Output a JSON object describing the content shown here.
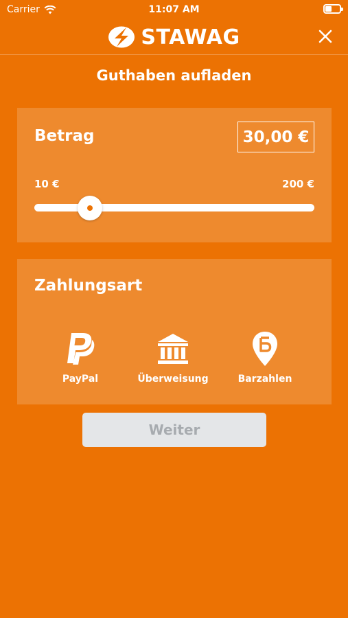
{
  "status_bar": {
    "carrier": "Carrier",
    "time": "11:07 AM",
    "wifi_icon": "wifi-icon",
    "battery_icon": "battery-icon"
  },
  "header": {
    "logo_text": "STAWAG",
    "logo_icon": "stawag-logo-icon",
    "close_icon": "close-icon"
  },
  "page": {
    "title": "Guthaben aufladen"
  },
  "amount_card": {
    "title": "Betrag",
    "value": "30,00 €",
    "slider": {
      "min_label": "10 €",
      "max_label": "200 €",
      "min": 10,
      "max": 200,
      "value": 30
    }
  },
  "payment_card": {
    "title": "Zahlungsart",
    "methods": [
      {
        "label": "PayPal",
        "icon": "paypal-icon"
      },
      {
        "label": "Überweisung",
        "icon": "bank-icon"
      },
      {
        "label": "Barzahlen",
        "icon": "barzahlen-pin-icon"
      }
    ]
  },
  "continue_button": {
    "label": "Weiter",
    "enabled": false
  },
  "colors": {
    "background": "#EC7203",
    "card": "#EE8A2E",
    "button_disabled_bg": "#E4E6E8",
    "button_disabled_text": "#A7ABAF"
  }
}
